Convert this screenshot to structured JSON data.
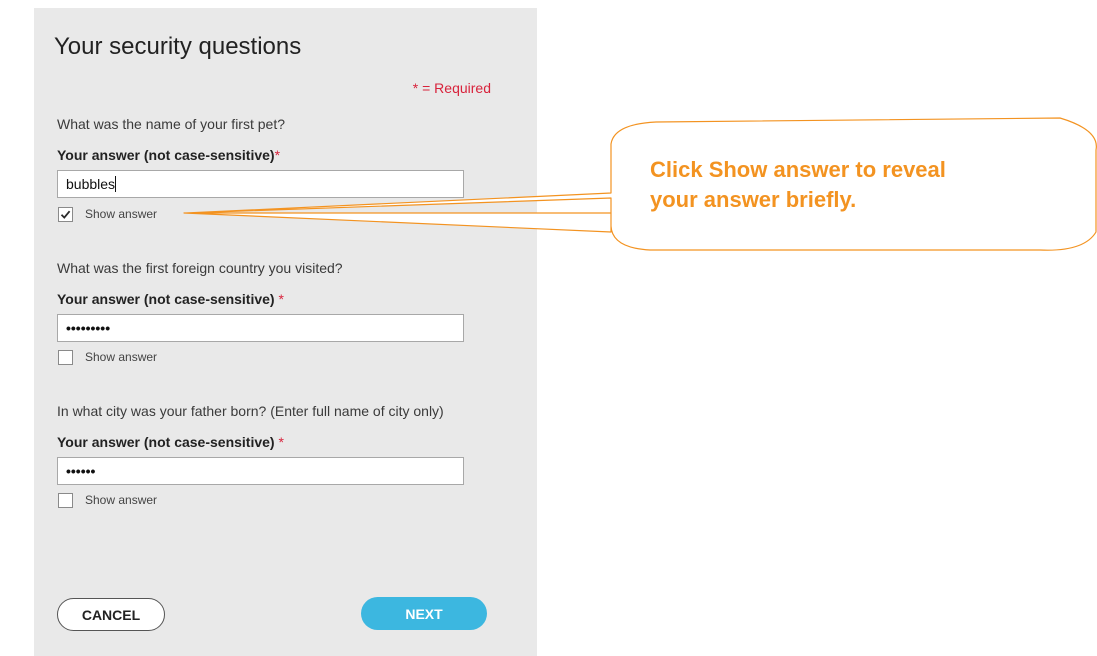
{
  "page": {
    "title": "Your security questions",
    "required_note": "* = Required"
  },
  "questions": [
    {
      "question": "What was the name of your first pet?",
      "answer_label": "Your answer (not case-sensitive)",
      "required_marker": "*",
      "answer_value": "bubbles",
      "show_answer_label": "Show answer",
      "show_answer_checked": true
    },
    {
      "question": "What was the first foreign country you visited?",
      "answer_label": "Your answer (not case-sensitive) ",
      "required_marker": "*",
      "answer_value": "•••••••••",
      "show_answer_label": "Show answer",
      "show_answer_checked": false
    },
    {
      "question": "In what city was your father born? (Enter full name of city only)",
      "answer_label": "Your answer (not case-sensitive) ",
      "required_marker": "*",
      "answer_value": "••••••",
      "show_answer_label": "Show answer",
      "show_answer_checked": false
    }
  ],
  "buttons": {
    "cancel_label": "CANCEL",
    "next_label": "NEXT"
  },
  "callout": {
    "line1": "Click Show answer to reveal",
    "line2": "your answer briefly."
  },
  "colors": {
    "panel_bg": "#e9e9e9",
    "required_red": "#d8233c",
    "next_blue": "#3cb7e0",
    "callout_orange": "#f39321"
  }
}
